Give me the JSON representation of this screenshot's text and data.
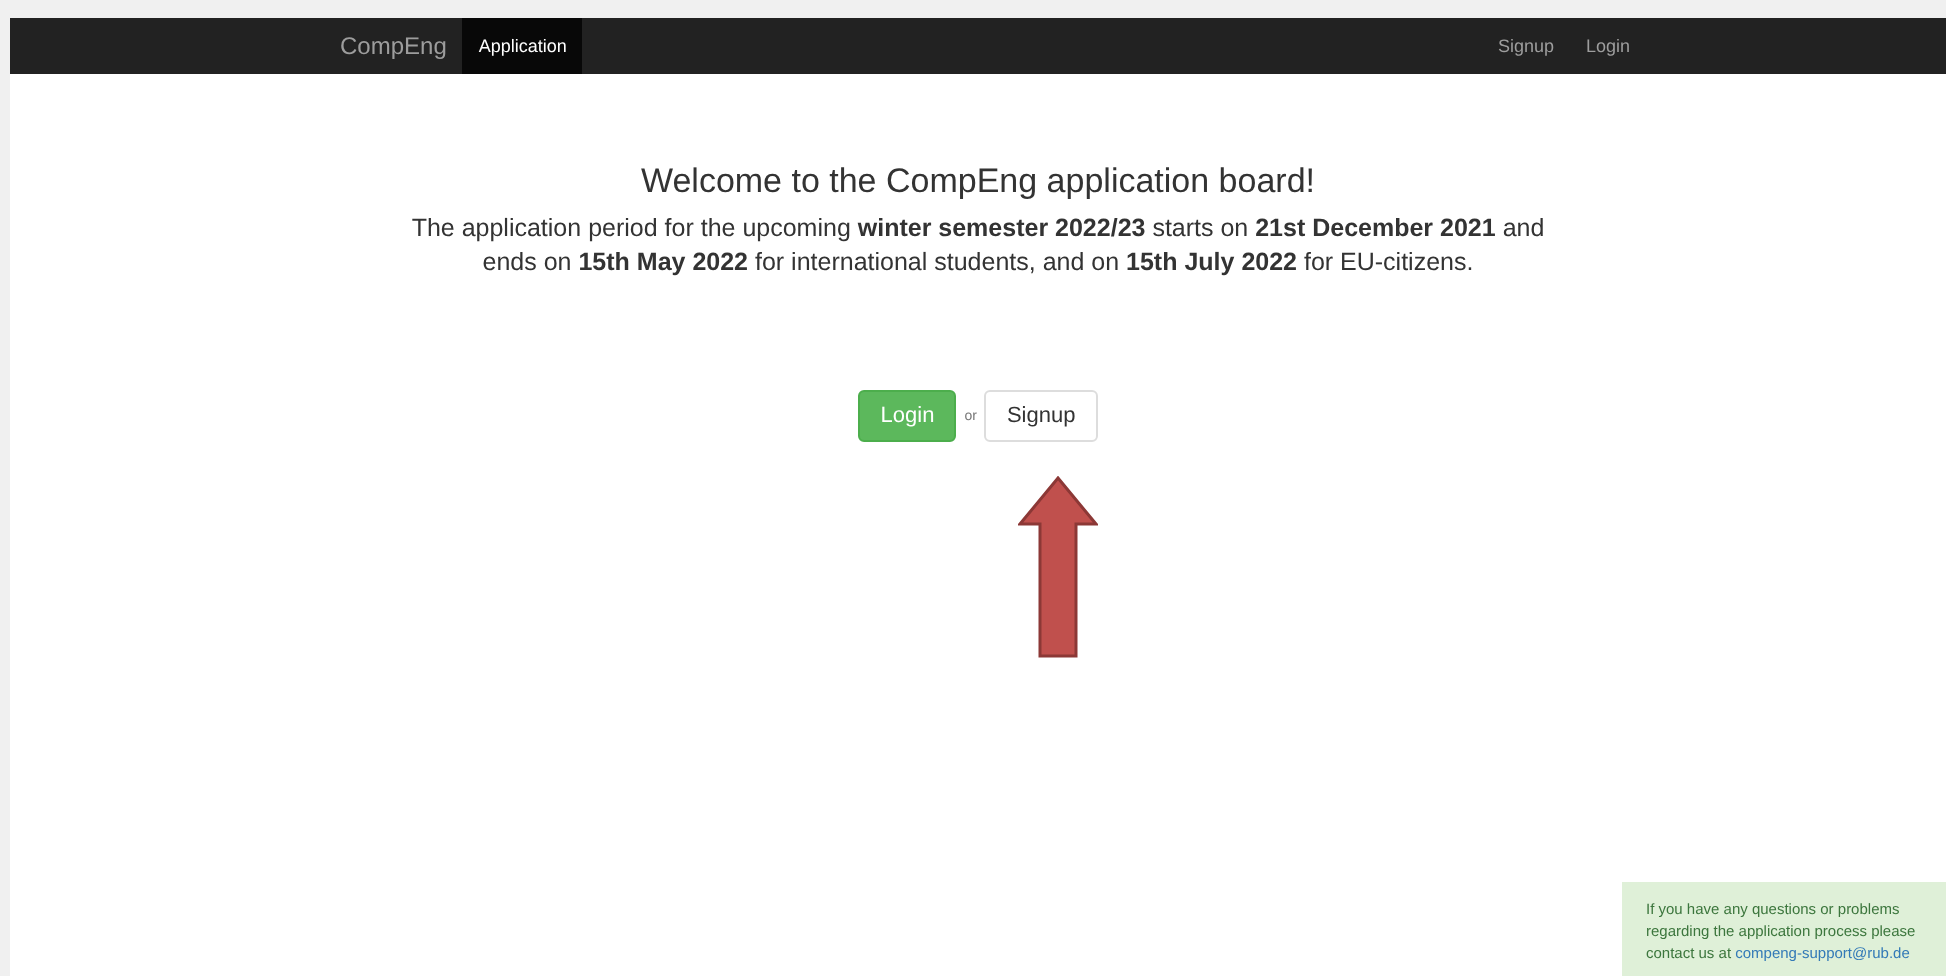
{
  "navbar": {
    "brand": "CompEng",
    "items": [
      {
        "label": "Application",
        "selected": true
      }
    ],
    "right_items": [
      {
        "label": "Signup"
      },
      {
        "label": "Login"
      }
    ]
  },
  "heading": "Welcome to the CompEng application board!",
  "intro": "The application period for the upcoming **winter semester 2022/23** starts on **21st December 2021** and ends on **15th May 2022** for international students, and on **15th July 2022** for EU-citizens.",
  "actions": {
    "login": "Login",
    "separator": "or",
    "signup": "Signup"
  },
  "support_note": {
    "text": "If you have any questions or problems regarding the application process please contact us at",
    "email": "compeng-support@rub.de"
  }
}
